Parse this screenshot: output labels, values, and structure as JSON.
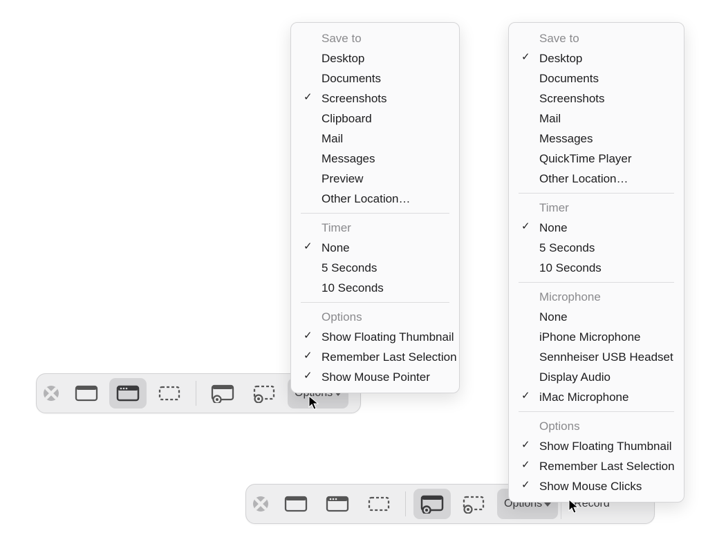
{
  "menu_left": {
    "sections": [
      {
        "title": "Save to",
        "items": [
          {
            "label": "Desktop",
            "checked": false
          },
          {
            "label": "Documents",
            "checked": false
          },
          {
            "label": "Screenshots",
            "checked": true
          },
          {
            "label": "Clipboard",
            "checked": false
          },
          {
            "label": "Mail",
            "checked": false
          },
          {
            "label": "Messages",
            "checked": false
          },
          {
            "label": "Preview",
            "checked": false
          },
          {
            "label": "Other Location…",
            "checked": false
          }
        ]
      },
      {
        "title": "Timer",
        "items": [
          {
            "label": "None",
            "checked": true
          },
          {
            "label": "5 Seconds",
            "checked": false
          },
          {
            "label": "10 Seconds",
            "checked": false
          }
        ]
      },
      {
        "title": "Options",
        "items": [
          {
            "label": "Show Floating Thumbnail",
            "checked": true
          },
          {
            "label": "Remember Last Selection",
            "checked": true
          },
          {
            "label": "Show Mouse Pointer",
            "checked": true
          }
        ]
      }
    ]
  },
  "menu_right": {
    "sections": [
      {
        "title": "Save to",
        "items": [
          {
            "label": "Desktop",
            "checked": true
          },
          {
            "label": "Documents",
            "checked": false
          },
          {
            "label": "Screenshots",
            "checked": false
          },
          {
            "label": "Mail",
            "checked": false
          },
          {
            "label": "Messages",
            "checked": false
          },
          {
            "label": "QuickTime Player",
            "checked": false
          },
          {
            "label": "Other Location…",
            "checked": false
          }
        ]
      },
      {
        "title": "Timer",
        "items": [
          {
            "label": "None",
            "checked": true
          },
          {
            "label": "5 Seconds",
            "checked": false
          },
          {
            "label": "10 Seconds",
            "checked": false
          }
        ]
      },
      {
        "title": "Microphone",
        "items": [
          {
            "label": "None",
            "checked": false
          },
          {
            "label": "iPhone Microphone",
            "checked": false
          },
          {
            "label": "Sennheiser USB Headset",
            "checked": false
          },
          {
            "label": "Display Audio",
            "checked": false
          },
          {
            "label": "iMac Microphone",
            "checked": true
          }
        ]
      },
      {
        "title": "Options",
        "items": [
          {
            "label": "Show Floating Thumbnail",
            "checked": true
          },
          {
            "label": "Remember Last Selection",
            "checked": true
          },
          {
            "label": "Show Mouse Clicks",
            "checked": true
          }
        ]
      }
    ]
  },
  "toolbar_left": {
    "options_label": "Options",
    "buttons": [
      {
        "name": "capture-entire-screen",
        "selected": false,
        "icon": "screen"
      },
      {
        "name": "capture-window",
        "selected": true,
        "icon": "window"
      },
      {
        "name": "capture-selection",
        "selected": false,
        "icon": "selection"
      },
      {
        "name": "record-entire-screen",
        "selected": false,
        "icon": "rec-screen"
      },
      {
        "name": "record-selection",
        "selected": false,
        "icon": "rec-selection"
      }
    ]
  },
  "toolbar_right": {
    "options_label": "Options",
    "record_label": "Record",
    "buttons": [
      {
        "name": "capture-entire-screen",
        "selected": false,
        "icon": "screen"
      },
      {
        "name": "capture-window",
        "selected": false,
        "icon": "window"
      },
      {
        "name": "capture-selection",
        "selected": false,
        "icon": "selection"
      },
      {
        "name": "record-entire-screen",
        "selected": true,
        "icon": "rec-screen"
      },
      {
        "name": "record-selection",
        "selected": false,
        "icon": "rec-selection"
      }
    ]
  }
}
